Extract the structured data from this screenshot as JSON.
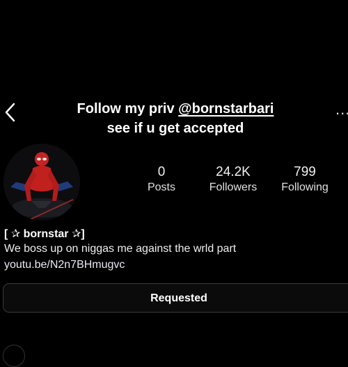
{
  "story": {
    "line1_prefix": "Follow my priv  ",
    "handle": "@bornstarbari",
    "line2": "see if u get accepted"
  },
  "profile": {
    "avatar_icon": "spiderman-avatar-icon",
    "stats": [
      {
        "value": "0",
        "label": "Posts"
      },
      {
        "value": "24.2K",
        "label": "Followers"
      },
      {
        "value": "799",
        "label": "Following"
      }
    ],
    "name": "[ ✰ bornstar ✰]",
    "bio": "We boss up on niggas me against the wrld part",
    "link": "youtu.be/N2n7BHmugvc"
  },
  "actions": {
    "requested_label": "Requested",
    "more_label": "..."
  }
}
